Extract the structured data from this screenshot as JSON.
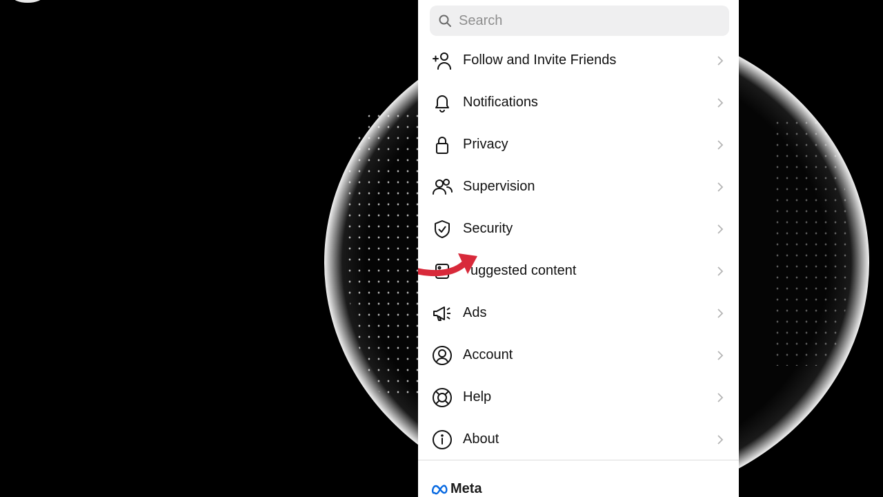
{
  "search": {
    "placeholder": "Search"
  },
  "menu": [
    {
      "label": "Follow and Invite Friends",
      "icon": "add-person-icon"
    },
    {
      "label": "Notifications",
      "icon": "bell-icon"
    },
    {
      "label": "Privacy",
      "icon": "lock-icon"
    },
    {
      "label": "Supervision",
      "icon": "people-icon"
    },
    {
      "label": "Security",
      "icon": "shield-check-icon"
    },
    {
      "label": "uggested content",
      "icon": "content-icon"
    },
    {
      "label": "Ads",
      "icon": "megaphone-icon"
    },
    {
      "label": "Account",
      "icon": "user-circle-icon"
    },
    {
      "label": "Help",
      "icon": "lifebuoy-icon"
    },
    {
      "label": "About",
      "icon": "info-icon"
    }
  ],
  "footer": {
    "brand": "Meta"
  },
  "colors": {
    "arrow": "#d8293a",
    "meta_blue": "#0668e1"
  }
}
